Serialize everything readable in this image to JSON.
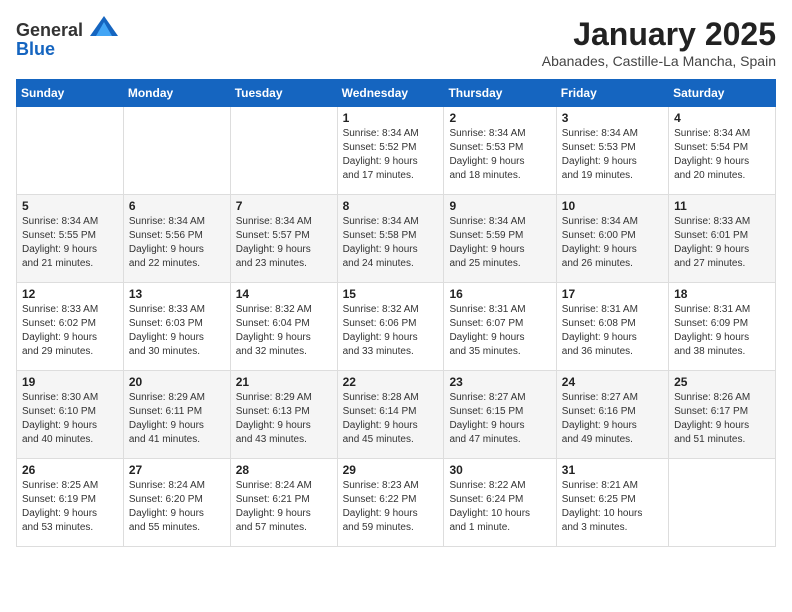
{
  "header": {
    "logo_general": "General",
    "logo_blue": "Blue",
    "month_title": "January 2025",
    "location": "Abanades, Castille-La Mancha, Spain"
  },
  "days_of_week": [
    "Sunday",
    "Monday",
    "Tuesday",
    "Wednesday",
    "Thursday",
    "Friday",
    "Saturday"
  ],
  "weeks": [
    [
      {
        "day": "",
        "info": ""
      },
      {
        "day": "",
        "info": ""
      },
      {
        "day": "",
        "info": ""
      },
      {
        "day": "1",
        "info": "Sunrise: 8:34 AM\nSunset: 5:52 PM\nDaylight: 9 hours\nand 17 minutes."
      },
      {
        "day": "2",
        "info": "Sunrise: 8:34 AM\nSunset: 5:53 PM\nDaylight: 9 hours\nand 18 minutes."
      },
      {
        "day": "3",
        "info": "Sunrise: 8:34 AM\nSunset: 5:53 PM\nDaylight: 9 hours\nand 19 minutes."
      },
      {
        "day": "4",
        "info": "Sunrise: 8:34 AM\nSunset: 5:54 PM\nDaylight: 9 hours\nand 20 minutes."
      }
    ],
    [
      {
        "day": "5",
        "info": "Sunrise: 8:34 AM\nSunset: 5:55 PM\nDaylight: 9 hours\nand 21 minutes."
      },
      {
        "day": "6",
        "info": "Sunrise: 8:34 AM\nSunset: 5:56 PM\nDaylight: 9 hours\nand 22 minutes."
      },
      {
        "day": "7",
        "info": "Sunrise: 8:34 AM\nSunset: 5:57 PM\nDaylight: 9 hours\nand 23 minutes."
      },
      {
        "day": "8",
        "info": "Sunrise: 8:34 AM\nSunset: 5:58 PM\nDaylight: 9 hours\nand 24 minutes."
      },
      {
        "day": "9",
        "info": "Sunrise: 8:34 AM\nSunset: 5:59 PM\nDaylight: 9 hours\nand 25 minutes."
      },
      {
        "day": "10",
        "info": "Sunrise: 8:34 AM\nSunset: 6:00 PM\nDaylight: 9 hours\nand 26 minutes."
      },
      {
        "day": "11",
        "info": "Sunrise: 8:33 AM\nSunset: 6:01 PM\nDaylight: 9 hours\nand 27 minutes."
      }
    ],
    [
      {
        "day": "12",
        "info": "Sunrise: 8:33 AM\nSunset: 6:02 PM\nDaylight: 9 hours\nand 29 minutes."
      },
      {
        "day": "13",
        "info": "Sunrise: 8:33 AM\nSunset: 6:03 PM\nDaylight: 9 hours\nand 30 minutes."
      },
      {
        "day": "14",
        "info": "Sunrise: 8:32 AM\nSunset: 6:04 PM\nDaylight: 9 hours\nand 32 minutes."
      },
      {
        "day": "15",
        "info": "Sunrise: 8:32 AM\nSunset: 6:06 PM\nDaylight: 9 hours\nand 33 minutes."
      },
      {
        "day": "16",
        "info": "Sunrise: 8:31 AM\nSunset: 6:07 PM\nDaylight: 9 hours\nand 35 minutes."
      },
      {
        "day": "17",
        "info": "Sunrise: 8:31 AM\nSunset: 6:08 PM\nDaylight: 9 hours\nand 36 minutes."
      },
      {
        "day": "18",
        "info": "Sunrise: 8:31 AM\nSunset: 6:09 PM\nDaylight: 9 hours\nand 38 minutes."
      }
    ],
    [
      {
        "day": "19",
        "info": "Sunrise: 8:30 AM\nSunset: 6:10 PM\nDaylight: 9 hours\nand 40 minutes."
      },
      {
        "day": "20",
        "info": "Sunrise: 8:29 AM\nSunset: 6:11 PM\nDaylight: 9 hours\nand 41 minutes."
      },
      {
        "day": "21",
        "info": "Sunrise: 8:29 AM\nSunset: 6:13 PM\nDaylight: 9 hours\nand 43 minutes."
      },
      {
        "day": "22",
        "info": "Sunrise: 8:28 AM\nSunset: 6:14 PM\nDaylight: 9 hours\nand 45 minutes."
      },
      {
        "day": "23",
        "info": "Sunrise: 8:27 AM\nSunset: 6:15 PM\nDaylight: 9 hours\nand 47 minutes."
      },
      {
        "day": "24",
        "info": "Sunrise: 8:27 AM\nSunset: 6:16 PM\nDaylight: 9 hours\nand 49 minutes."
      },
      {
        "day": "25",
        "info": "Sunrise: 8:26 AM\nSunset: 6:17 PM\nDaylight: 9 hours\nand 51 minutes."
      }
    ],
    [
      {
        "day": "26",
        "info": "Sunrise: 8:25 AM\nSunset: 6:19 PM\nDaylight: 9 hours\nand 53 minutes."
      },
      {
        "day": "27",
        "info": "Sunrise: 8:24 AM\nSunset: 6:20 PM\nDaylight: 9 hours\nand 55 minutes."
      },
      {
        "day": "28",
        "info": "Sunrise: 8:24 AM\nSunset: 6:21 PM\nDaylight: 9 hours\nand 57 minutes."
      },
      {
        "day": "29",
        "info": "Sunrise: 8:23 AM\nSunset: 6:22 PM\nDaylight: 9 hours\nand 59 minutes."
      },
      {
        "day": "30",
        "info": "Sunrise: 8:22 AM\nSunset: 6:24 PM\nDaylight: 10 hours\nand 1 minute."
      },
      {
        "day": "31",
        "info": "Sunrise: 8:21 AM\nSunset: 6:25 PM\nDaylight: 10 hours\nand 3 minutes."
      },
      {
        "day": "",
        "info": ""
      }
    ]
  ]
}
